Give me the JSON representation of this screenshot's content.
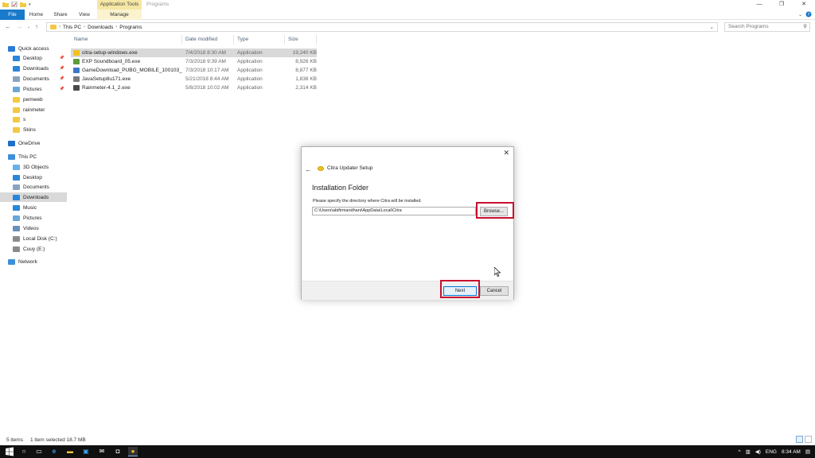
{
  "window": {
    "context_tab": "Application Tools",
    "title": "Programs",
    "controls": [
      "—",
      "❐",
      "✕"
    ]
  },
  "ribbon": {
    "tabs": [
      {
        "label": "File",
        "active": true
      },
      {
        "label": "Home"
      },
      {
        "label": "Share"
      },
      {
        "label": "View"
      },
      {
        "label": "Manage",
        "contextual": true
      }
    ]
  },
  "address": {
    "crumbs": [
      "This PC",
      "Downloads",
      "Programs"
    ],
    "search_placeholder": "Search Programs"
  },
  "nav": {
    "items": [
      {
        "label": "Quick access",
        "icon": "star-icon",
        "color": "#2a7bd8",
        "level": 0
      },
      {
        "label": "Desktop",
        "icon": "desktop-icon",
        "color": "#2b86d9",
        "level": 1,
        "pinned": true
      },
      {
        "label": "Downloads",
        "icon": "downloads-icon",
        "color": "#2b86d9",
        "level": 1,
        "pinned": true
      },
      {
        "label": "Documents",
        "icon": "documents-icon",
        "color": "#8aa3c0",
        "level": 1,
        "pinned": true
      },
      {
        "label": "Pictures",
        "icon": "pictures-icon",
        "color": "#6aa7d8",
        "level": 1,
        "pinned": true
      },
      {
        "label": "pemweb",
        "icon": "folder-icon",
        "color": "#f3c844",
        "level": 1
      },
      {
        "label": "rainmeter",
        "icon": "folder-icon",
        "color": "#f3c844",
        "level": 1
      },
      {
        "label": "s",
        "icon": "folder-icon",
        "color": "#f3c844",
        "level": 1
      },
      {
        "label": "Skins",
        "icon": "folder-icon",
        "color": "#f3c844",
        "level": 1
      },
      {
        "label": "OneDrive",
        "icon": "cloud-icon",
        "color": "#1e6fc9",
        "level": 0
      },
      {
        "label": "This PC",
        "icon": "computer-icon",
        "color": "#3d8fd9",
        "level": 0
      },
      {
        "label": "3D Objects",
        "icon": "3d-objects-icon",
        "color": "#6ab0e8",
        "level": 1
      },
      {
        "label": "Desktop",
        "icon": "desktop-icon",
        "color": "#2b86d9",
        "level": 1
      },
      {
        "label": "Documents",
        "icon": "documents-icon",
        "color": "#8aa3c0",
        "level": 1
      },
      {
        "label": "Downloads",
        "icon": "downloads-icon",
        "color": "#2b86d9",
        "level": 1,
        "selected": true
      },
      {
        "label": "Music",
        "icon": "music-icon",
        "color": "#2b86d9",
        "level": 1
      },
      {
        "label": "Pictures",
        "icon": "pictures-icon",
        "color": "#6aa7d8",
        "level": 1
      },
      {
        "label": "Videos",
        "icon": "videos-icon",
        "color": "#6a8fb8",
        "level": 1
      },
      {
        "label": "Local Disk (C:)",
        "icon": "drive-icon",
        "color": "#8b8b8b",
        "level": 1
      },
      {
        "label": "Cuuy (E:)",
        "icon": "drive-icon",
        "color": "#8b8b8b",
        "level": 1
      },
      {
        "label": "Network",
        "icon": "network-icon",
        "color": "#3d8fd9",
        "level": 0
      }
    ]
  },
  "files": {
    "columns": [
      "Name",
      "Date modified",
      "Type",
      "Size"
    ],
    "rows": [
      {
        "name": "citra-setup-windows.exe",
        "date": "7/4/2018 8:30 AM",
        "type": "Application",
        "size": "19,240 KB",
        "icon_color": "#f1c21b",
        "selected": true
      },
      {
        "name": "EXP Soundboard_05.exe",
        "date": "7/3/2018 9:39 AM",
        "type": "Application",
        "size": "8,926 KB",
        "icon_color": "#5a9e3a"
      },
      {
        "name": "GameDownload_PUBG_MOBILE_100103_...",
        "date": "7/3/2018 10:17 AM",
        "type": "Application",
        "size": "8,877 KB",
        "icon_color": "#3c78c8"
      },
      {
        "name": "JavaSetup8u171.exe",
        "date": "5/21/2018 8:44 AM",
        "type": "Application",
        "size": "1,838 KB",
        "icon_color": "#7a7a7a"
      },
      {
        "name": "Rainmeter-4.1_2.exe",
        "date": "5/8/2018 10:02 AM",
        "type": "Application",
        "size": "2,314 KB",
        "icon_color": "#4a4a4a"
      }
    ]
  },
  "status": {
    "count": "5 items",
    "selection": "1 item selected  18.7 MB"
  },
  "dialog": {
    "title": "Citra Updater Setup",
    "heading": "Installation Folder",
    "description": "Please specify the directory where Citra will be installed.",
    "path": "C:\\Users\\abifirmandhani\\AppData\\Local\\Citra",
    "browse_label": "Browse...",
    "next_label": "Next",
    "cancel_label": "Cancel",
    "highlight_color": "#c8102e"
  },
  "taskbar": {
    "language": "ENG",
    "time": "8:34 AM"
  }
}
